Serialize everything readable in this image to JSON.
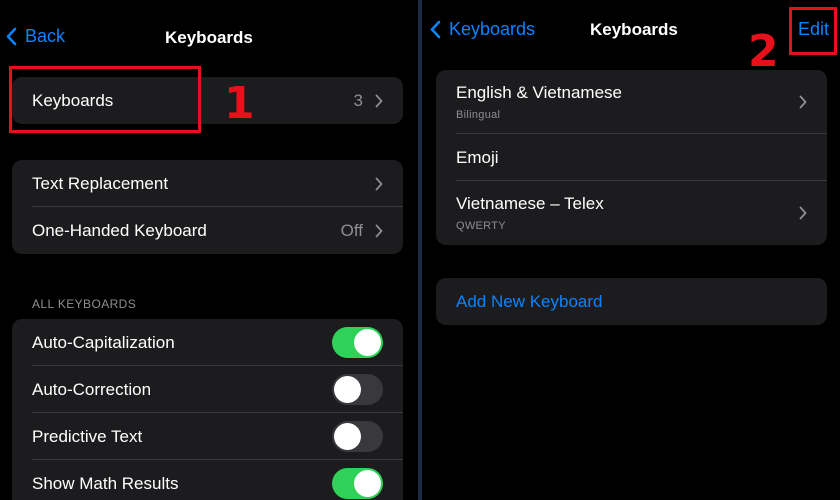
{
  "left": {
    "nav": {
      "back_label": "Back",
      "title": "Keyboards"
    },
    "keyboards_row": {
      "label": "Keyboards",
      "value": "3"
    },
    "settings_rows": [
      {
        "label": "Text Replacement",
        "value": ""
      },
      {
        "label": "One-Handed Keyboard",
        "value": "Off"
      }
    ],
    "section_header": "ALL KEYBOARDS",
    "toggles": [
      {
        "label": "Auto-Capitalization",
        "on": true
      },
      {
        "label": "Auto-Correction",
        "on": false
      },
      {
        "label": "Predictive Text",
        "on": false
      },
      {
        "label": "Show Math Results",
        "on": true
      }
    ]
  },
  "right": {
    "nav": {
      "back_label": "Keyboards",
      "title": "Keyboards",
      "edit_label": "Edit"
    },
    "keyboards": [
      {
        "name": "English & Vietnamese",
        "subtitle": "Bilingual"
      },
      {
        "name": "Emoji",
        "subtitle": ""
      },
      {
        "name": "Vietnamese – Telex",
        "subtitle": "QWERTY"
      }
    ],
    "add_label": "Add New Keyboard"
  },
  "annotations": {
    "step1": "1",
    "step2": "2"
  },
  "colors": {
    "accent": "#0a84ff",
    "toggle_on": "#30d158",
    "highlight": "#e8101a",
    "cell": "#1c1c1e"
  },
  "icons": [
    "chevron-left-icon",
    "chevron-right-icon"
  ]
}
